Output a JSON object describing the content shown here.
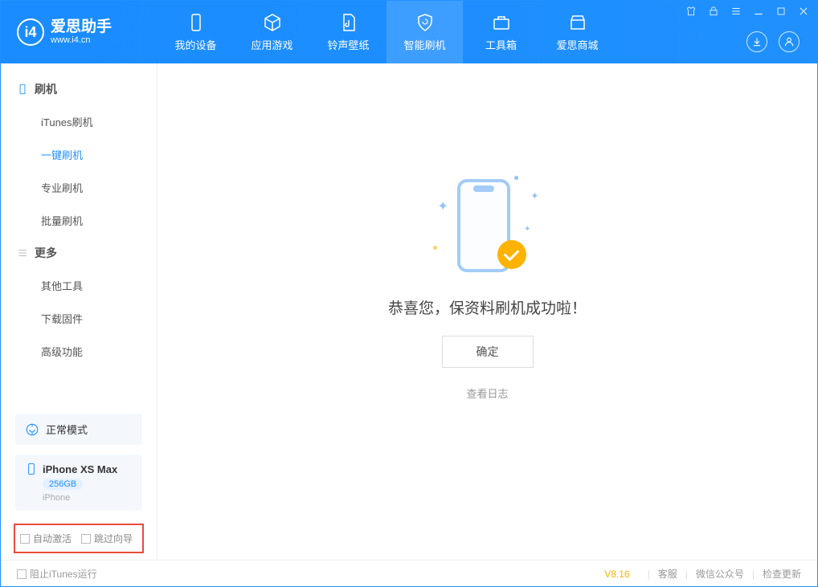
{
  "header": {
    "logo_title": "爱思助手",
    "logo_sub": "www.i4.cn",
    "tabs": [
      {
        "label": "我的设备"
      },
      {
        "label": "应用游戏"
      },
      {
        "label": "铃声壁纸"
      },
      {
        "label": "智能刷机"
      },
      {
        "label": "工具箱"
      },
      {
        "label": "爱思商城"
      }
    ]
  },
  "sidebar": {
    "section_flash": "刷机",
    "items_flash": [
      {
        "label": "iTunes刷机"
      },
      {
        "label": "一键刷机"
      },
      {
        "label": "专业刷机"
      },
      {
        "label": "批量刷机"
      }
    ],
    "section_more": "更多",
    "items_more": [
      {
        "label": "其他工具"
      },
      {
        "label": "下载固件"
      },
      {
        "label": "高级功能"
      }
    ],
    "mode_label": "正常模式",
    "device": {
      "name": "iPhone XS Max",
      "storage": "256GB",
      "type": "iPhone"
    },
    "checkbox_auto_activate": "自动激活",
    "checkbox_skip_guide": "跳过向导"
  },
  "main": {
    "success_message": "恭喜您，保资料刷机成功啦！",
    "confirm_label": "确定",
    "view_log_label": "查看日志"
  },
  "footer": {
    "block_itunes": "阻止iTunes运行",
    "version": "V8.16",
    "link_service": "客服",
    "link_wechat": "微信公众号",
    "link_update": "检查更新"
  }
}
